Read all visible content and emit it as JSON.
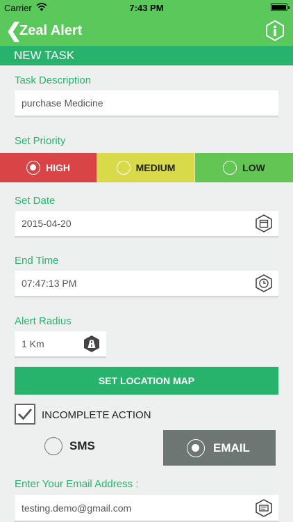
{
  "status_bar": {
    "carrier": "Carrier",
    "time": "7:43 PM"
  },
  "nav": {
    "back_icon": "chevron-left-icon",
    "title": "Zeal Alert",
    "info_icon": "info-hex-icon"
  },
  "section_header": "NEW TASK",
  "task_description": {
    "label": "Task Description",
    "value": "purchase Medicine"
  },
  "priority": {
    "label": "Set Priority",
    "options": [
      "HIGH",
      "MEDIUM",
      "LOW"
    ],
    "selected": "HIGH",
    "colors": {
      "high": "#d94446",
      "medium": "#d9da4a",
      "low": "#63c553"
    }
  },
  "set_date": {
    "label": "Set Date",
    "value": "2015-04-20",
    "icon": "calendar-icon"
  },
  "end_time": {
    "label": "End Time",
    "value": "07:47:13 PM",
    "icon": "clock-icon"
  },
  "alert_radius": {
    "label": "Alert Radius",
    "value": "1 Km",
    "icon": "road-icon"
  },
  "buttons": {
    "set_location": "SET LOCATION MAP"
  },
  "incomplete_action": {
    "label": "INCOMPLETE ACTION",
    "checked": true
  },
  "notify": {
    "sms_label": "SMS",
    "email_label": "EMAIL",
    "selected": "EMAIL"
  },
  "email": {
    "label": "Enter Your Email Address :",
    "value": "testing.demo@gmail.com",
    "icon": "id-card-icon"
  },
  "colors": {
    "accent_green": "#27b36b",
    "nav_green": "#5ac85a",
    "email_selected_bg": "#6d7673"
  }
}
